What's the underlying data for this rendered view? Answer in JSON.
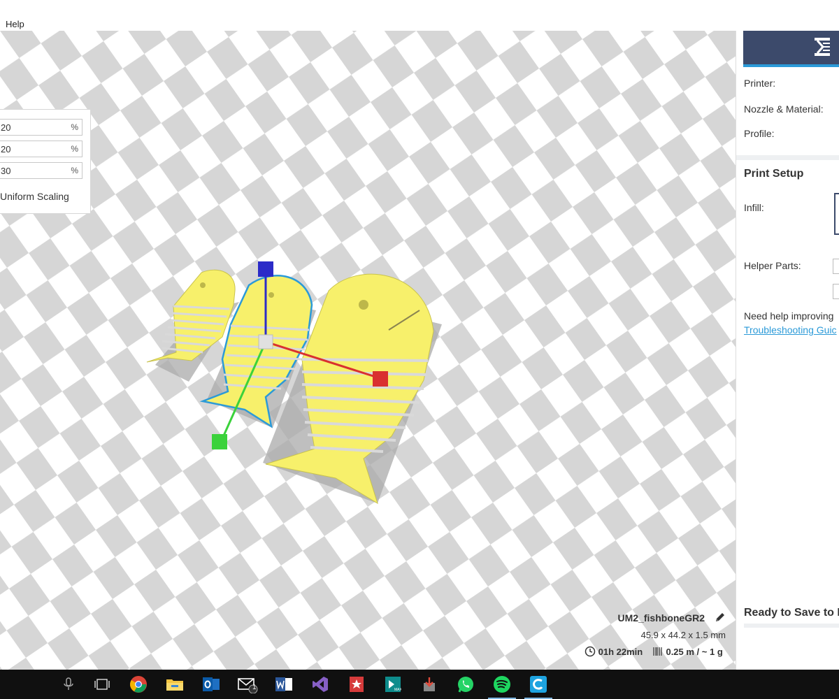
{
  "menubar": {
    "help_label": "Help"
  },
  "scale_panel": {
    "x": {
      "value": "20",
      "unit": "%"
    },
    "y": {
      "value": "20",
      "unit": "%"
    },
    "z": {
      "value": "30",
      "unit": "%"
    },
    "uniform_label": "Uniform Scaling"
  },
  "right_panel": {
    "printer_label": "Printer:",
    "nozzle_label": "Nozzle & Material:",
    "profile_label": "Profile:",
    "print_setup_title": "Print Setup",
    "infill_label": "Infill:",
    "helper_parts_label": "Helper Parts:",
    "help_text": "Need help improving",
    "help_link": "Troubleshooting Guic",
    "ready_label": "Ready to Save to I"
  },
  "job": {
    "name": "UM2_fishboneGR2",
    "dimensions": "45.9 x 44.2 x 1.5 mm",
    "print_time": "01h 22min",
    "material": "0.25 m / ~ 1 g"
  },
  "colors": {
    "model_yellow": "#f7f06b",
    "selection_outline": "#2b9ad8",
    "axis_x": "#d93030",
    "axis_y": "#3bd23b",
    "axis_z": "#2b2bc8",
    "brand_dark": "#3c4a6b"
  },
  "taskbar": {
    "icons": [
      "microphone-icon",
      "task-view-icon",
      "chrome-icon",
      "file-explorer-icon",
      "outlook-icon",
      "mail-icon",
      "word-icon",
      "visual-studio-icon",
      "wunderlist-icon",
      "3dsmax-icon",
      "installer-icon",
      "whatsapp-icon",
      "spotify-icon",
      "cura-icon"
    ],
    "mail_badge": "1"
  }
}
